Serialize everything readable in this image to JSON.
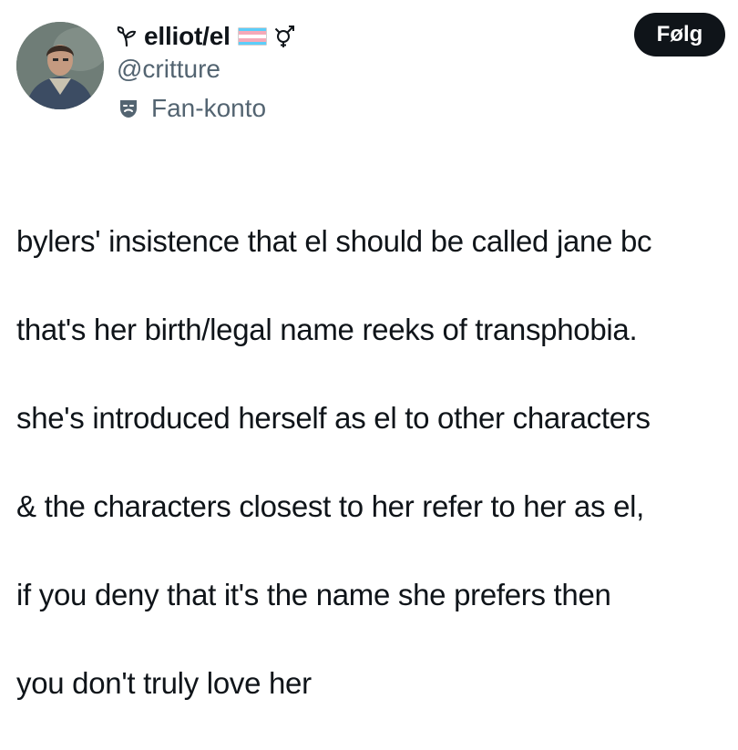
{
  "author": {
    "display_name": "elliot/el",
    "name_prefix_icon": "leaf-sprout-icon",
    "name_suffix_icons": [
      "trans-flag-icon",
      "gender-symbol-icon"
    ],
    "handle": "@critture",
    "account_label": "Fan-konto",
    "account_label_icon": "theater-mask-icon"
  },
  "follow_button": {
    "label": "Følg"
  },
  "colors": {
    "text_primary": "#0f1419",
    "text_secondary": "#536471",
    "button_bg": "#0f1419",
    "button_text": "#ffffff",
    "background": "#ffffff"
  },
  "tweet": {
    "lines": [
      "bylers' insistence that el should be called jane bc",
      "that's her birth/legal name reeks of transphobia.",
      "she's introduced herself as el to other characters",
      "& the characters closest to her refer to her as el,",
      "if you deny that it's the name she prefers then",
      "you don't truly love her"
    ]
  }
}
